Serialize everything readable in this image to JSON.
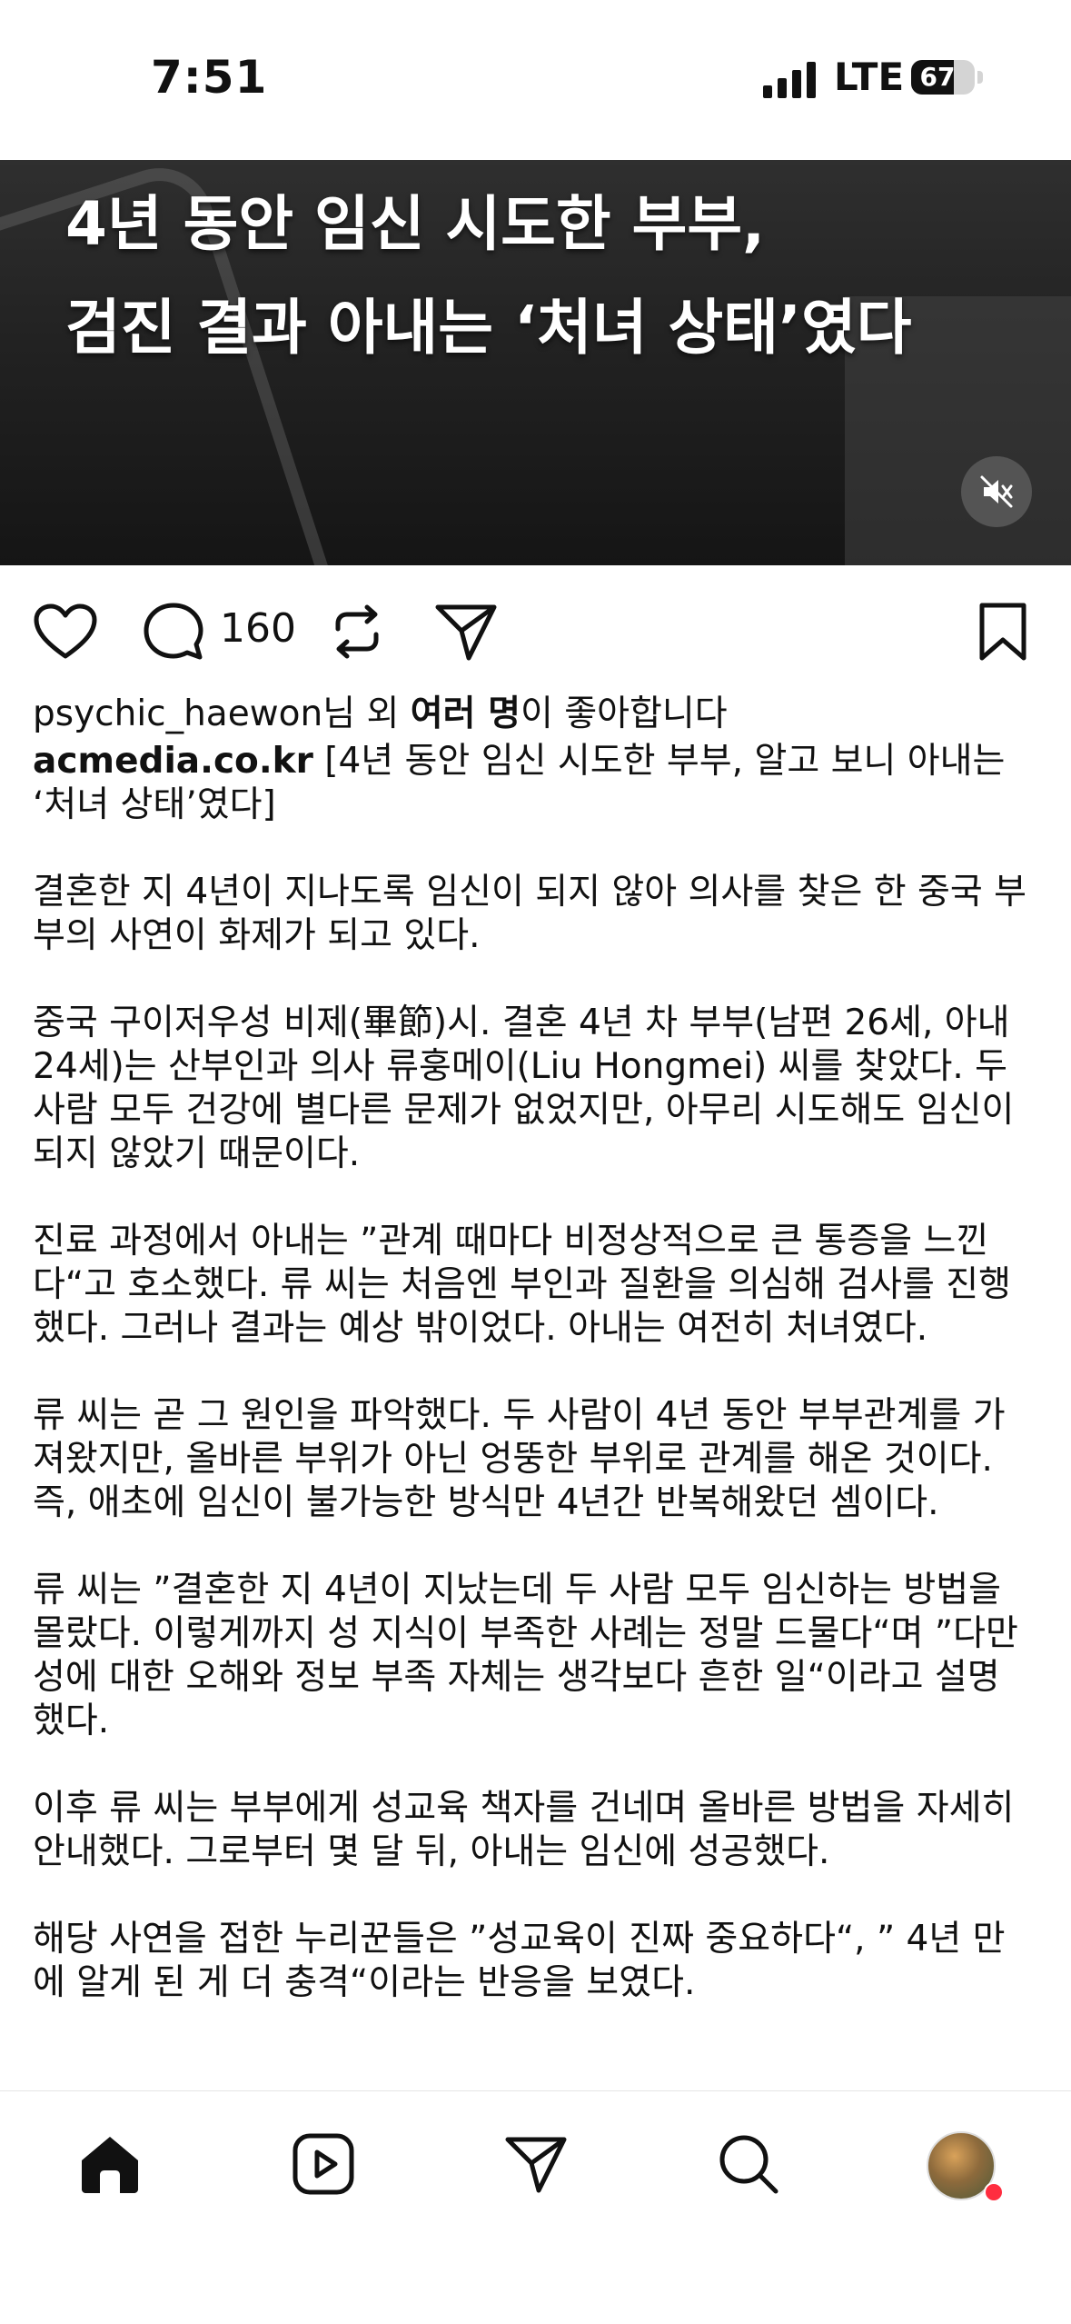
{
  "status_bar": {
    "time": "7:51",
    "network": "LTE",
    "battery_level": 67,
    "battery_text": "67"
  },
  "video": {
    "headline_line1": "4년 동안 임신 시도한 부부,",
    "headline_line2": "검진 결과 아내는 ‘처녀 상태’였다",
    "mute_icon": "speaker-muted-icon"
  },
  "actions": {
    "like_icon": "heart-icon",
    "comment_icon": "comment-bubble-icon",
    "comment_count": "160",
    "repost_icon": "repost-icon",
    "share_icon": "paper-plane-icon",
    "save_icon": "bookmark-icon"
  },
  "likes": {
    "user": "psychic_haewon",
    "connector": "님 외 ",
    "others": "여러 명",
    "suffix": "이 좋아합니다"
  },
  "caption": {
    "account": "acmedia.co.kr",
    "title": " [4년 동안 임신 시도한 부부, 알고 보니 아내는 ‘처녀 상태’였다]",
    "paragraphs": [
      "결혼한 지 4년이 지나도록 임신이 되지 않아 의사를 찾은 한 중국 부부의 사연이 화제가 되고 있다.",
      "중국 구이저우성 비제(畢節)시. 결혼 4년 차 부부(남편 26세, 아내 24세)는 산부인과 의사 류훙메이(Liu Hongmei) 씨를 찾았다. 두 사람 모두 건강에 별다른 문제가 없었지만, 아무리 시도해도 임신이 되지 않았기 때문이다.",
      "진료 과정에서 아내는 ”관계 때마다 비정상적으로 큰 통증을 느낀다“고 호소했다. 류 씨는 처음엔 부인과 질환을 의심해 검사를 진행했다. 그러나 결과는 예상 밖이었다. 아내는 여전히 처녀였다.",
      "류 씨는 곧 그 원인을 파악했다. 두 사람이 4년 동안 부부관계를 가져왔지만, 올바른 부위가 아닌 엉뚱한 부위로 관계를 해온 것이다. 즉, 애초에 임신이 불가능한 방식만 4년간 반복해왔던 셈이다.",
      "류 씨는 ”결혼한 지 4년이 지났는데 두 사람 모두 임신하는 방법을 몰랐다. 이렇게까지 성 지식이 부족한 사례는 정말 드물다“며 ”다만 성에 대한 오해와 정보 부족 자체는 생각보다 흔한 일“이라고 설명했다.",
      "이후 류 씨는 부부에게 성교육 책자를 건네며 올바른 방법을 자세히 안내했다. 그로부터 몇 달 뒤, 아내는 임신에 성공했다.",
      "해당 사연을 접한 누리꾼들은 ”성교육이 진짜 중요하다“, ” 4년 만에 알게 된 게 더 충격“이라는 반응을 보였다."
    ]
  },
  "nav": {
    "home_icon": "home-icon",
    "reels_icon": "reels-icon",
    "direct_icon": "paper-plane-icon",
    "search_icon": "search-icon",
    "profile_icon": "profile-avatar"
  }
}
